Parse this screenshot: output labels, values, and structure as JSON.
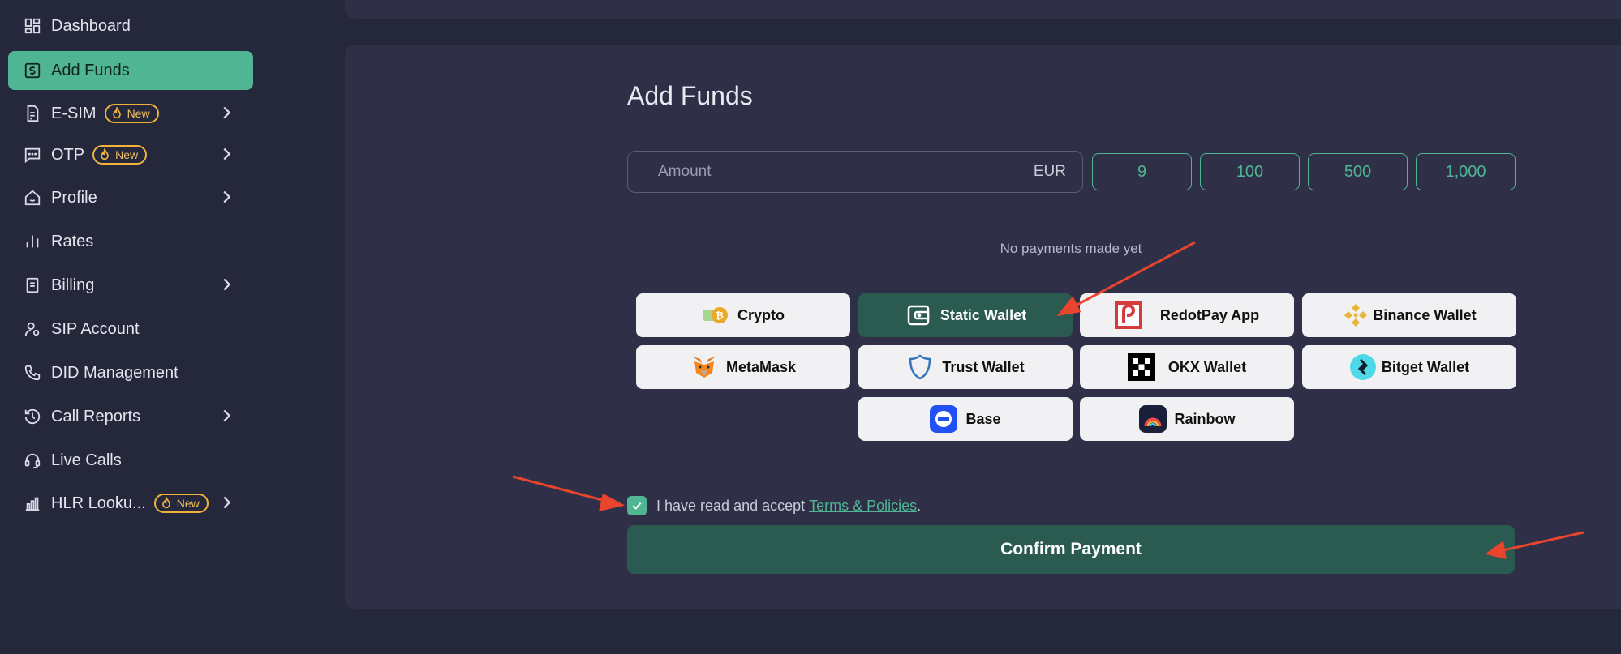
{
  "sidebar": {
    "items": [
      {
        "label": "Dashboard",
        "icon": "dashboard-icon"
      },
      {
        "label": "Add Funds",
        "icon": "dollar-card-icon",
        "active": true
      },
      {
        "label": "E-SIM",
        "icon": "sim-icon",
        "badge": "New"
      },
      {
        "label": "OTP",
        "icon": "message-icon",
        "badge": "New"
      },
      {
        "label": "Profile",
        "icon": "home-icon"
      },
      {
        "label": "Rates",
        "icon": "bars-icon"
      },
      {
        "label": "Billing",
        "icon": "document-icon"
      },
      {
        "label": "SIP Account",
        "icon": "user-gear-icon"
      },
      {
        "label": "DID Management",
        "icon": "phone-icon"
      },
      {
        "label": "Call Reports",
        "icon": "history-icon"
      },
      {
        "label": "Live Calls",
        "icon": "headset-icon"
      },
      {
        "label": "HLR Looku...",
        "icon": "chart-icon",
        "badge": "New"
      }
    ]
  },
  "main": {
    "title": "Add Funds",
    "amount": {
      "placeholder": "Amount",
      "value": "",
      "currency": "EUR"
    },
    "presets": [
      "9",
      "100",
      "500",
      "1,000"
    ],
    "no_payments": "No payments made yet",
    "methods": [
      {
        "label": "Crypto",
        "icon": "crypto-coins-icon"
      },
      {
        "label": "Static Wallet",
        "icon": "wallet-icon",
        "selected": true
      },
      {
        "label": "RedotPay App",
        "icon": "redotpay-logo-icon"
      },
      {
        "label": "Binance Wallet",
        "icon": "binance-logo-icon"
      },
      {
        "label": "MetaMask",
        "icon": "metamask-fox-icon"
      },
      {
        "label": "Trust Wallet",
        "icon": "trust-shield-icon"
      },
      {
        "label": "OKX Wallet",
        "icon": "okx-logo-icon"
      },
      {
        "label": "Bitget Wallet",
        "icon": "bitget-logo-icon"
      },
      {
        "label": "Base",
        "icon": "base-logo-icon"
      },
      {
        "label": "Rainbow",
        "icon": "rainbow-logo-icon"
      }
    ],
    "terms": {
      "text": "I have read and accept",
      "link": "Terms & Policies",
      "suffix": ".",
      "checked": true
    },
    "confirm_label": "Confirm Payment"
  },
  "colors": {
    "accent": "#4fb592",
    "selected": "#2a5a50",
    "badge": "#f0b23a",
    "annotation": "#e8442e"
  }
}
